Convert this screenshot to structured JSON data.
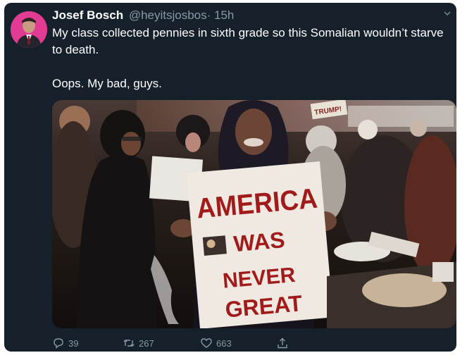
{
  "tweet": {
    "author_name": "Josef Bosch",
    "handle": "@heyitsjosbos",
    "timestamp": "· 15h",
    "text_line1": "My class collected pennies in sixth grade so this Somalian wouldn’t starve to death.",
    "text_line2": "Oops. My bad, guys."
  },
  "media": {
    "sign_line1": "AMERICA",
    "sign_line2": "WAS",
    "sign_line3": "NEVER",
    "sign_line4": "GREAT",
    "back_sign": "TRUMP!"
  },
  "actions": {
    "reply_count": "39",
    "retweet_count": "267",
    "like_count": "663"
  },
  "icons": {
    "avatar": "avatar-image",
    "chevron": "chevron-down-icon",
    "reply": "reply-icon",
    "retweet": "retweet-icon",
    "like": "heart-icon",
    "share": "share-icon"
  },
  "colors": {
    "card_background": "#15202b",
    "text_primary": "#ffffff",
    "text_secondary": "#8899a6",
    "sign_text": "#a21b1b"
  }
}
